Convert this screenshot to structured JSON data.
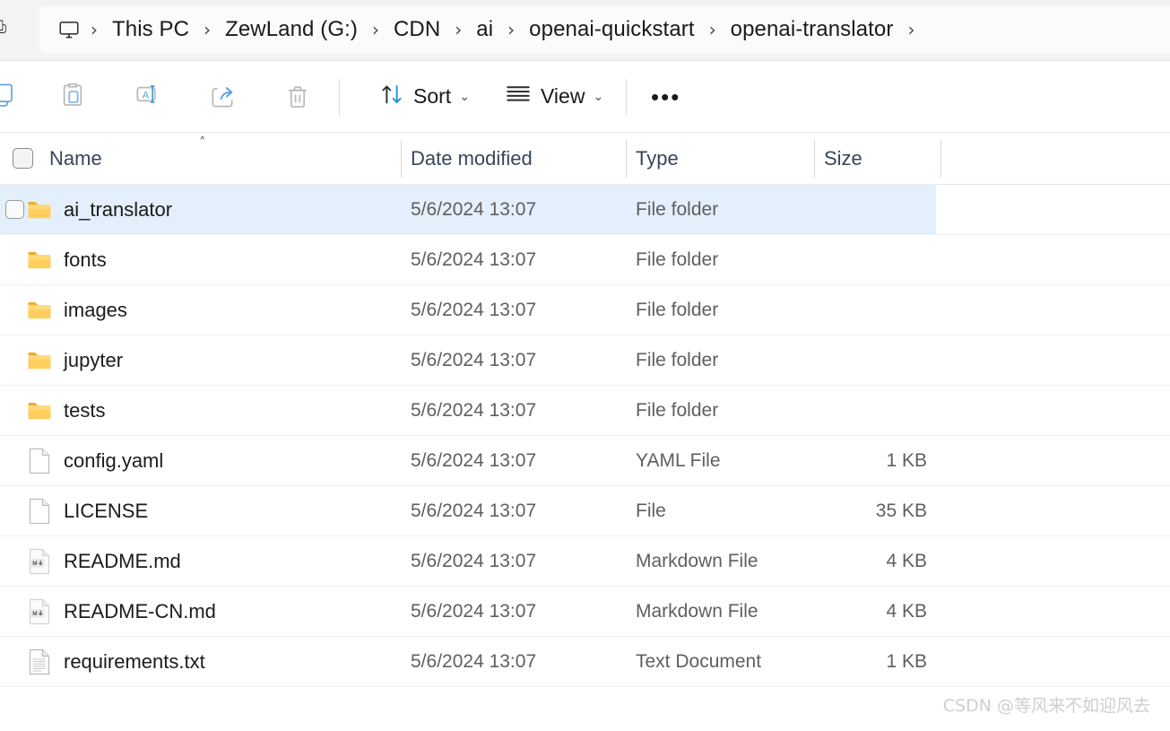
{
  "addressbar": {
    "pc_icon": "monitor-icon",
    "crumbs": [
      {
        "label": "This PC"
      },
      {
        "label": "ZewLand (G:)"
      },
      {
        "label": "CDN"
      },
      {
        "label": "ai"
      },
      {
        "label": "openai-quickstart"
      },
      {
        "label": "openai-translator"
      }
    ],
    "separator": "›"
  },
  "toolbar": {
    "buttons": [
      {
        "name": "copy-button",
        "icon": "copy-icon",
        "label": ""
      },
      {
        "name": "paste-button",
        "icon": "paste-icon",
        "label": ""
      },
      {
        "name": "rename-button",
        "icon": "rename-icon",
        "label": ""
      },
      {
        "name": "share-button",
        "icon": "share-icon",
        "label": ""
      },
      {
        "name": "delete-button",
        "icon": "trash-icon",
        "label": ""
      }
    ],
    "sort_label": "Sort",
    "sort_icon": "sort-arrows-icon",
    "view_label": "View",
    "view_icon": "view-lines-icon",
    "more_label": "•••",
    "more_icon": "ellipsis-icon",
    "caret": "⌄"
  },
  "columns": {
    "select_all": "select-all-checkbox",
    "sort_indicator": "˄",
    "headers": [
      "Name",
      "Date modified",
      "Type",
      "Size"
    ]
  },
  "files": [
    {
      "name": "ai_translator",
      "date": "5/6/2024 13:07",
      "type": "File folder",
      "size": "",
      "icon": "folder-icon",
      "selected": true,
      "checkbox": true
    },
    {
      "name": "fonts",
      "date": "5/6/2024 13:07",
      "type": "File folder",
      "size": "",
      "icon": "folder-icon",
      "selected": false,
      "checkbox": false
    },
    {
      "name": "images",
      "date": "5/6/2024 13:07",
      "type": "File folder",
      "size": "",
      "icon": "folder-icon",
      "selected": false,
      "checkbox": false
    },
    {
      "name": "jupyter",
      "date": "5/6/2024 13:07",
      "type": "File folder",
      "size": "",
      "icon": "folder-icon",
      "selected": false,
      "checkbox": false
    },
    {
      "name": "tests",
      "date": "5/6/2024 13:07",
      "type": "File folder",
      "size": "",
      "icon": "folder-icon",
      "selected": false,
      "checkbox": false
    },
    {
      "name": "config.yaml",
      "date": "5/6/2024 13:07",
      "type": "YAML File",
      "size": "1 KB",
      "icon": "blank-file-icon",
      "selected": false,
      "checkbox": false
    },
    {
      "name": "LICENSE",
      "date": "5/6/2024 13:07",
      "type": "File",
      "size": "35 KB",
      "icon": "blank-file-icon",
      "selected": false,
      "checkbox": false
    },
    {
      "name": "README.md",
      "date": "5/6/2024 13:07",
      "type": "Markdown File",
      "size": "4 KB",
      "icon": "markdown-file-icon",
      "selected": false,
      "checkbox": false
    },
    {
      "name": "README-CN.md",
      "date": "5/6/2024 13:07",
      "type": "Markdown File",
      "size": "4 KB",
      "icon": "markdown-file-icon",
      "selected": false,
      "checkbox": false
    },
    {
      "name": "requirements.txt",
      "date": "5/6/2024 13:07",
      "type": "Text Document",
      "size": "1 KB",
      "icon": "text-file-icon",
      "selected": false,
      "checkbox": false
    }
  ],
  "watermark": {
    "text": "CSDN @等风来不如迎风去"
  },
  "colors": {
    "selection": "#e3f0fc",
    "folder": "#ffc societal",
    "accent": "#0f6cbd",
    "header_text": "#38455a",
    "body_text": "#1b1b1b",
    "muted_text": "#5f5f5f"
  }
}
